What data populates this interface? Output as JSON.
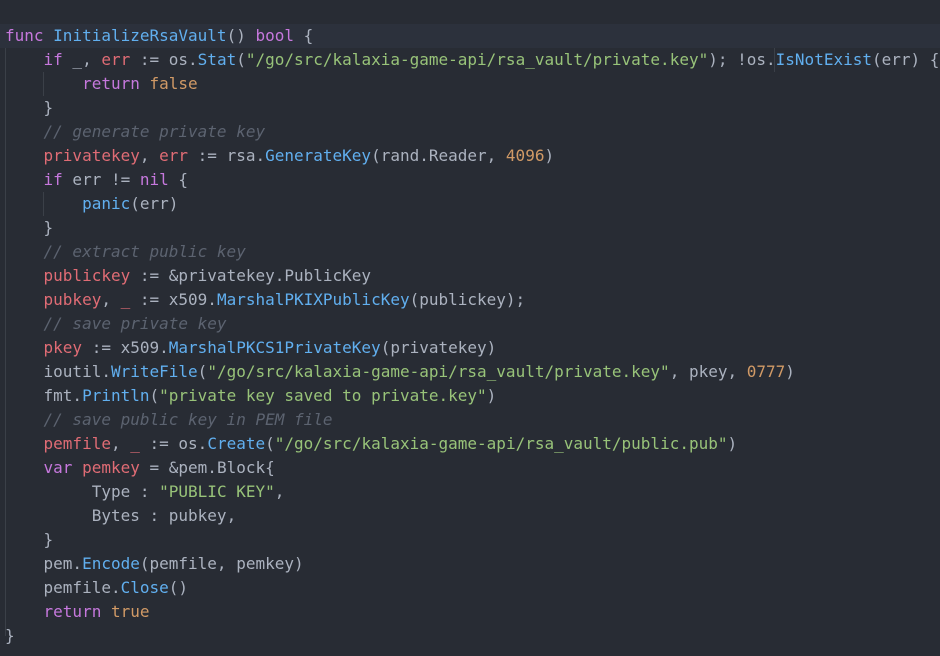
{
  "editor": {
    "lines": [
      {
        "indent": "",
        "tokens": [
          [
            "kw",
            "func"
          ],
          [
            "pl",
            " "
          ],
          [
            "fn",
            "InitializeRsaVault"
          ],
          [
            "pl",
            "() "
          ],
          [
            "kw",
            "bool"
          ],
          [
            "pl",
            " {"
          ]
        ]
      },
      {
        "indent": "    ",
        "tokens": [
          [
            "kw",
            "if"
          ],
          [
            "pl",
            " _, "
          ],
          [
            "var",
            "err"
          ],
          [
            "pl",
            " := os."
          ],
          [
            "fn",
            "Stat"
          ],
          [
            "pl",
            "("
          ],
          [
            "str",
            "\"/go/src/kalaxia-game-api/rsa_vault/private.key\""
          ],
          [
            "pl",
            "); !os."
          ],
          [
            "fn",
            "IsNotExist"
          ],
          [
            "pl",
            "(err) {"
          ]
        ]
      },
      {
        "indent": "        ",
        "tokens": [
          [
            "kw",
            "return"
          ],
          [
            "pl",
            " "
          ],
          [
            "num",
            "false"
          ]
        ]
      },
      {
        "indent": "    ",
        "tokens": [
          [
            "pl",
            "}"
          ]
        ]
      },
      {
        "indent": "    ",
        "tokens": [
          [
            "cm",
            "// generate private key"
          ]
        ]
      },
      {
        "indent": "    ",
        "tokens": [
          [
            "var",
            "privatekey"
          ],
          [
            "pl",
            ", "
          ],
          [
            "var",
            "err"
          ],
          [
            "pl",
            " := rsa."
          ],
          [
            "fn",
            "GenerateKey"
          ],
          [
            "pl",
            "(rand.Reader, "
          ],
          [
            "num",
            "4096"
          ],
          [
            "pl",
            ")"
          ]
        ]
      },
      {
        "indent": "    ",
        "tokens": [
          [
            "kw",
            "if"
          ],
          [
            "pl",
            " err != "
          ],
          [
            "kw",
            "nil"
          ],
          [
            "pl",
            " {"
          ]
        ]
      },
      {
        "indent": "        ",
        "tokens": [
          [
            "fn",
            "panic"
          ],
          [
            "pl",
            "(err)"
          ]
        ]
      },
      {
        "indent": "    ",
        "tokens": [
          [
            "pl",
            "}"
          ]
        ]
      },
      {
        "indent": "    ",
        "tokens": [
          [
            "cm",
            "// extract public key"
          ]
        ]
      },
      {
        "indent": "    ",
        "tokens": [
          [
            "var",
            "publickey"
          ],
          [
            "pl",
            " := &privatekey.PublicKey"
          ]
        ]
      },
      {
        "indent": "    ",
        "tokens": [
          [
            "var",
            "pubkey"
          ],
          [
            "pl",
            ", "
          ],
          [
            "var",
            "_"
          ],
          [
            "pl",
            " := x509."
          ],
          [
            "fn",
            "MarshalPKIXPublicKey"
          ],
          [
            "pl",
            "(publickey);"
          ]
        ]
      },
      {
        "indent": "    ",
        "tokens": [
          [
            "cm",
            "// save private key"
          ]
        ]
      },
      {
        "indent": "    ",
        "tokens": [
          [
            "var",
            "pkey"
          ],
          [
            "pl",
            " := x509."
          ],
          [
            "fn",
            "MarshalPKCS1PrivateKey"
          ],
          [
            "pl",
            "(privatekey)"
          ]
        ]
      },
      {
        "indent": "    ",
        "tokens": [
          [
            "pl",
            "ioutil."
          ],
          [
            "fn",
            "WriteFile"
          ],
          [
            "pl",
            "("
          ],
          [
            "str",
            "\"/go/src/kalaxia-game-api/rsa_vault/private.key\""
          ],
          [
            "pl",
            ", pkey, "
          ],
          [
            "num",
            "0777"
          ],
          [
            "pl",
            ")"
          ]
        ]
      },
      {
        "indent": "    ",
        "tokens": [
          [
            "pl",
            "fmt."
          ],
          [
            "fn",
            "Println"
          ],
          [
            "pl",
            "("
          ],
          [
            "str",
            "\"private key saved to private.key\""
          ],
          [
            "pl",
            ")"
          ]
        ]
      },
      {
        "indent": "    ",
        "tokens": [
          [
            "cm",
            "// save public key in PEM file"
          ]
        ]
      },
      {
        "indent": "    ",
        "tokens": [
          [
            "var",
            "pemfile"
          ],
          [
            "pl",
            ", "
          ],
          [
            "var",
            "_"
          ],
          [
            "pl",
            " := os."
          ],
          [
            "fn",
            "Create"
          ],
          [
            "pl",
            "("
          ],
          [
            "str",
            "\"/go/src/kalaxia-game-api/rsa_vault/public.pub\""
          ],
          [
            "pl",
            ")"
          ]
        ]
      },
      {
        "indent": "    ",
        "tokens": [
          [
            "kw",
            "var"
          ],
          [
            "pl",
            " "
          ],
          [
            "var",
            "pemkey"
          ],
          [
            "pl",
            " = &pem.Block{"
          ]
        ]
      },
      {
        "indent": "         ",
        "tokens": [
          [
            "pl",
            "Type : "
          ],
          [
            "str",
            "\"PUBLIC KEY\""
          ],
          [
            "pl",
            ","
          ]
        ]
      },
      {
        "indent": "         ",
        "tokens": [
          [
            "pl",
            "Bytes : pubkey,"
          ]
        ]
      },
      {
        "indent": "    ",
        "tokens": [
          [
            "pl",
            "}"
          ]
        ]
      },
      {
        "indent": "    ",
        "tokens": [
          [
            "pl",
            "pem."
          ],
          [
            "fn",
            "Encode"
          ],
          [
            "pl",
            "(pemfile, pemkey)"
          ]
        ]
      },
      {
        "indent": "    ",
        "tokens": [
          [
            "pl",
            "pemfile."
          ],
          [
            "fn",
            "Close"
          ],
          [
            "pl",
            "()"
          ]
        ]
      },
      {
        "indent": "    ",
        "tokens": [
          [
            "kw",
            "return"
          ],
          [
            "pl",
            " "
          ],
          [
            "num",
            "true"
          ]
        ]
      },
      {
        "indent": "",
        "tokens": [
          [
            "pl",
            "}"
          ]
        ]
      }
    ]
  }
}
